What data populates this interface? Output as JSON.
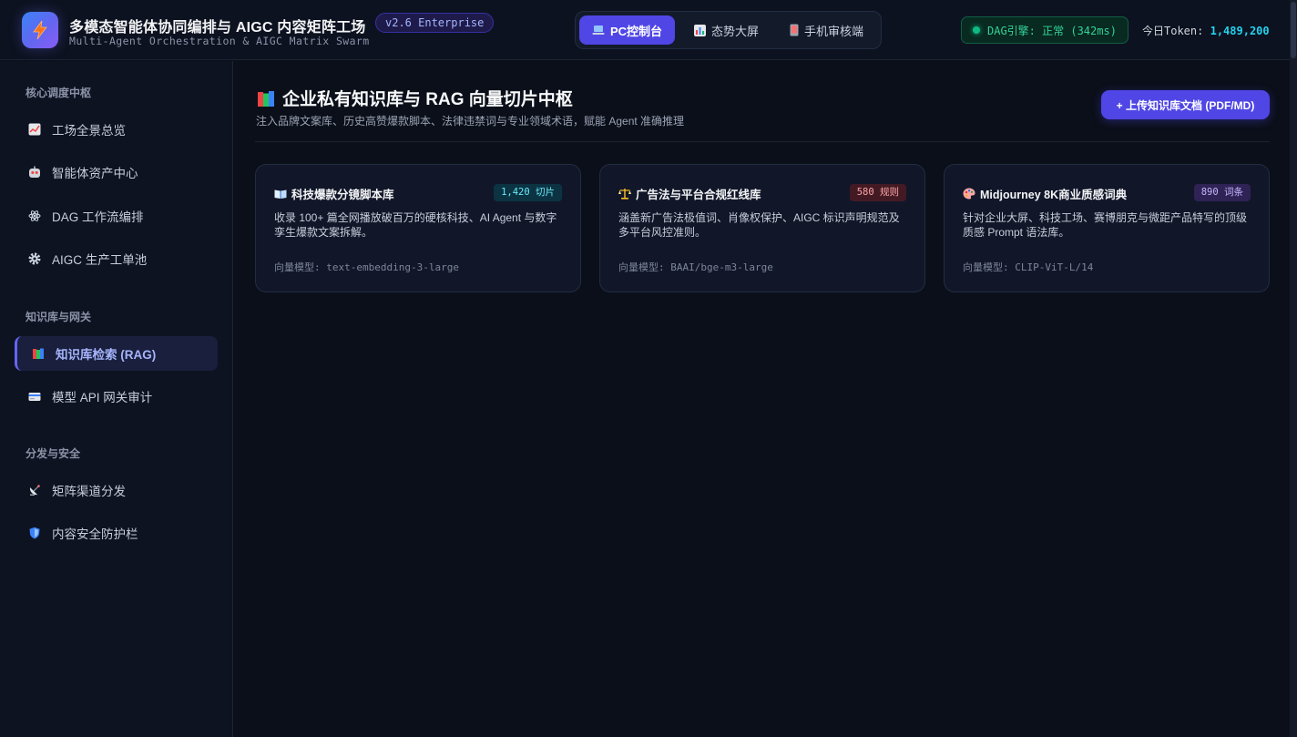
{
  "header": {
    "title": "多模态智能体协同编排与 AIGC 内容矩阵工场",
    "version": "v2.6 Enterprise",
    "subtitle": "Multi-Agent Orchestration & AIGC Matrix Swarm",
    "view_tabs": [
      {
        "label": "PC控制台",
        "icon": "laptop-icon"
      },
      {
        "label": "态势大屏",
        "icon": "bar-chart-icon"
      },
      {
        "label": "手机审核端",
        "icon": "mobile-phone-icon"
      }
    ],
    "engine_status": "DAG引擎: 正常 (342ms)",
    "token_label": "今日Token:",
    "token_value": "1,489,200"
  },
  "sidebar": {
    "groups": [
      {
        "title": "核心调度中枢",
        "items": [
          {
            "label": "工场全景总览",
            "icon": "trend-chart-icon"
          },
          {
            "label": "智能体资产中心",
            "icon": "robot-icon"
          },
          {
            "label": "DAG 工作流编排",
            "icon": "atom-icon"
          },
          {
            "label": "AIGC 生产工单池",
            "icon": "gear-icon"
          }
        ]
      },
      {
        "title": "知识库与网关",
        "items": [
          {
            "label": "知识库检索 (RAG)",
            "icon": "books-icon"
          },
          {
            "label": "模型 API 网关审计",
            "icon": "credit-card-icon"
          }
        ]
      },
      {
        "title": "分发与安全",
        "items": [
          {
            "label": "矩阵渠道分发",
            "icon": "satellite-dish-icon"
          },
          {
            "label": "内容安全防护栏",
            "icon": "shield-icon"
          }
        ]
      }
    ]
  },
  "main": {
    "title": "企业私有知识库与 RAG 向量切片中枢",
    "title_icon": "books-icon",
    "subtitle": "注入品牌文案库、历史高赞爆款脚本、法律违禁词与专业领域术语，赋能 Agent 准确推理",
    "upload_label": "+ 上传知识库文档 (PDF/MD)",
    "cards": [
      {
        "title": "科技爆款分镜脚本库",
        "icon": "open-book-icon",
        "badge": "1,420 切片",
        "desc": "收录 100+ 篇全网播放破百万的硬核科技、AI Agent 与数字孪生爆款文案拆解。",
        "model": "向量模型: text-embedding-3-large"
      },
      {
        "title": "广告法与平台合规红线库",
        "icon": "balance-scale-icon",
        "badge": "580 规则",
        "desc": "涵盖新广告法极值词、肖像权保护、AIGC 标识声明规范及多平台风控准则。",
        "model": "向量模型: BAAI/bge-m3-large"
      },
      {
        "title": "Midjourney 8K商业质感词典",
        "icon": "palette-icon",
        "badge": "890 词条",
        "desc": "针对企业大屏、科技工场、赛博朋克与微距产品特写的顶级质感 Prompt 语法库。",
        "model": "向量模型: CLIP-ViT-L/14"
      }
    ]
  },
  "colors": {
    "background": "#0b0f19",
    "accent": "#4f46e5",
    "status_ok": "#10b981",
    "token_value": "#22d3ee"
  }
}
